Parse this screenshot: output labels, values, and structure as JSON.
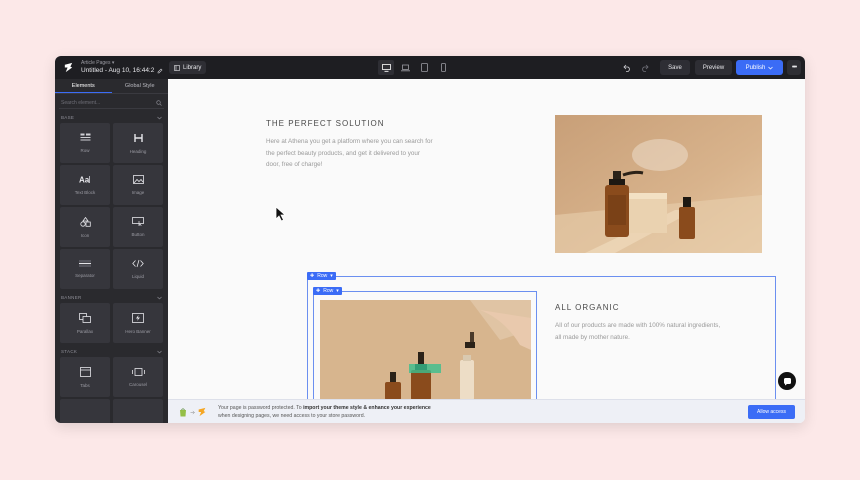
{
  "topbar": {
    "breadcrumb": "Article Pages ▾",
    "page_name": "Untitled - Aug 10, 16:44:2",
    "library_label": "Library",
    "save_label": "Save",
    "preview_label": "Preview",
    "publish_label": "Publish",
    "more_label": "•••",
    "devices": [
      "desktop-icon",
      "laptop-icon",
      "tablet-icon",
      "mobile-icon"
    ]
  },
  "sidebar": {
    "tabs": [
      "Elements",
      "Global Style"
    ],
    "search_placeholder": "Search element...",
    "sections": [
      {
        "title": "BASE",
        "items": [
          "Row",
          "Heading",
          "Text Block",
          "Image",
          "Icon",
          "Button",
          "Separator",
          "Liquid"
        ]
      },
      {
        "title": "BANNER",
        "items": [
          "Parallax",
          "Hero Banner"
        ]
      },
      {
        "title": "STACK",
        "items": [
          "Tabs",
          "Carousel"
        ]
      }
    ]
  },
  "canvas": {
    "block1": {
      "title": "THE PERFECT SOLUTION",
      "lines": [
        "Here at Athena you get a platform where you can search for",
        "the perfect beauty products, and get it delivered to your",
        "door, free of charge!"
      ]
    },
    "block2": {
      "title": "ALL ORGANIC",
      "lines": [
        "All of our products are made with 100% natural ingredients,",
        "all made by mother nature."
      ]
    },
    "row_tag": "Row",
    "inner_row_tag": "Row"
  },
  "banner": {
    "text_prefix": "Your page is password protected. To ",
    "text_bold": "import your theme style & enhance your experience",
    "text_line2": "when designing pages, we need access to your store password.",
    "allow_label": "Allow access"
  },
  "colors": {
    "accent": "#3b6cf6",
    "dark": "#1e1e22",
    "background": "#fce8e8"
  }
}
